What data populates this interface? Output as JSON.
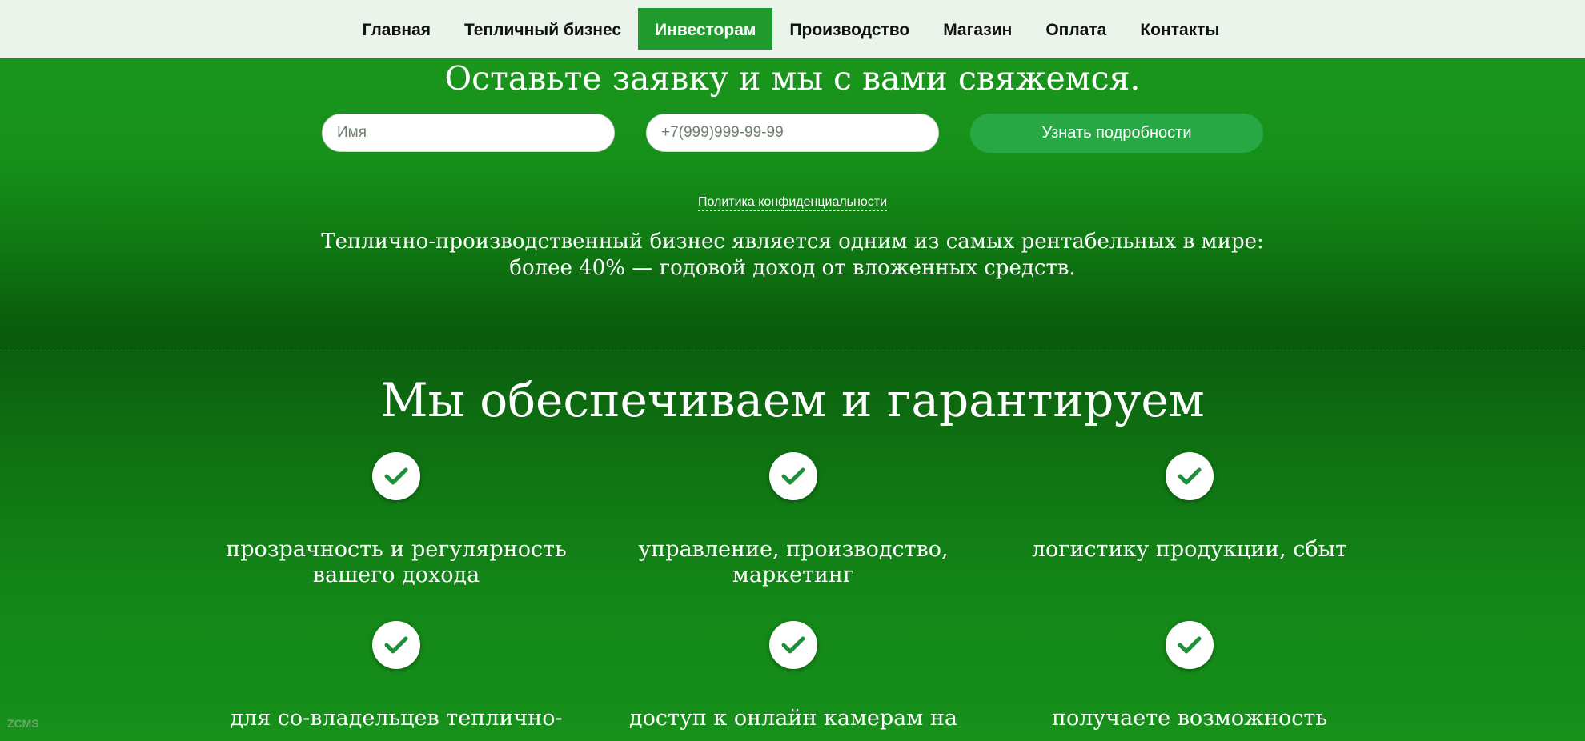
{
  "nav": {
    "items": [
      {
        "label": "Главная",
        "active": false
      },
      {
        "label": "Тепличный бизнес",
        "active": false
      },
      {
        "label": "Инвесторам",
        "active": true
      },
      {
        "label": "Производство",
        "active": false
      },
      {
        "label": "Магазин",
        "active": false
      },
      {
        "label": "Оплата",
        "active": false
      },
      {
        "label": "Контакты",
        "active": false
      }
    ]
  },
  "hero": {
    "title": "Оставьте заявку и мы с вами свяжемся.",
    "name_placeholder": "Имя",
    "phone_placeholder": "+7(999)999-99-99",
    "submit_label": "Узнать подробности",
    "privacy_label": "Политика конфиденциальности",
    "desc_line1": "Теплично-производственный бизнес является одним из самых рентабельных в мире:",
    "desc_line2": "более 40% — годовой доход от вложенных средств."
  },
  "guarantees": {
    "title": "Мы обеспечиваем и гарантируем",
    "items": [
      {
        "line1": "прозрачность и регулярность",
        "line2": "вашего дохода"
      },
      {
        "line1": "управление, производство,",
        "line2": "маркетинг"
      },
      {
        "line1": "логистику продукции, сбыт",
        "line2": ""
      },
      {
        "line1": "для со-владельцев теплично-",
        "line2": ""
      },
      {
        "line1": "доступ к онлайн камерам на",
        "line2": ""
      },
      {
        "line1": "получаете возможность",
        "line2": ""
      }
    ],
    "check_color": "#1f8f3a"
  },
  "watermark": "ZCMS",
  "colors": {
    "nav_bg": "#eaf4ea",
    "active_tab": "#1f9a2e",
    "button": "#28a745",
    "hero_green": "#17901a"
  }
}
